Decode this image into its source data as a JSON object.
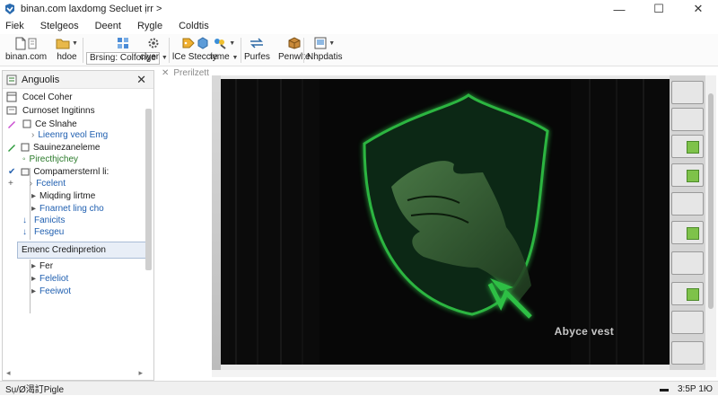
{
  "window": {
    "title": "binan.com  laxdomg Secluet  ịrr  >",
    "controls": {
      "minimize": "—",
      "maximize": "☐",
      "close": "✕"
    }
  },
  "menu": [
    "Fiek",
    "Stelgeos",
    "Deent",
    "Rygle",
    "Coldtis"
  ],
  "toolbar": {
    "buttons": [
      {
        "label": "binan.com",
        "icon": "new-document-icon"
      },
      {
        "label": "hdoe",
        "icon": "open-folder-icon"
      },
      {
        "label": "Brsing: Colfonge",
        "icon": "grid-icon"
      },
      {
        "label": "clyer",
        "icon": "settings-icon"
      },
      {
        "label": "lCe Steccie",
        "icon": "tag-icon"
      },
      {
        "label": "tyme",
        "icon": "paint-icon"
      },
      {
        "label": "Purfes",
        "icon": "swap-arrows-icon"
      },
      {
        "label": "Penwlte",
        "icon": "package-icon"
      },
      {
        "label": "Nhpdatis",
        "icon": "image-frame-icon"
      }
    ]
  },
  "panel": {
    "title": "Anguolis",
    "close": "✕",
    "items": [
      {
        "label": "Cocel Coher",
        "style": "normal"
      },
      {
        "label": "Curnoset Ingitinns",
        "style": "normal"
      },
      {
        "label": "Ce Slnahe",
        "style": "normal"
      },
      {
        "label": "Lieenrg veol Emg",
        "style": "blue"
      },
      {
        "label": "Sauinezaneleme",
        "style": "normal"
      },
      {
        "label": "Pirecthjchey",
        "style": "green"
      },
      {
        "label": "Compamersternl li:",
        "style": "normal"
      },
      {
        "label": "Fcelent",
        "style": "blue"
      },
      {
        "label": "Miqding lirtme",
        "style": "normal"
      },
      {
        "label": "Fnarnet ling cho",
        "style": "blue"
      },
      {
        "label": "Fanicits",
        "style": "blue"
      },
      {
        "label": "Fesgeu",
        "style": "blue"
      }
    ],
    "selected": "Emenc Credinpretion",
    "after": [
      {
        "label": "Fer",
        "style": "normal"
      },
      {
        "label": "Feleliot",
        "style": "blue"
      },
      {
        "label": "Feeiwot",
        "style": "blue"
      }
    ]
  },
  "document": {
    "tab": "Prerilzett"
  },
  "canvas": {
    "watermark": "Abyce vest"
  },
  "status": {
    "left": "Sụ/Ø渴訂Pigle",
    "position": "3:5Р 1Ю"
  },
  "colors": {
    "shield_green": "#2fbf44",
    "scene_bg": "#070707",
    "accent_blue": "#1f5fb0"
  }
}
